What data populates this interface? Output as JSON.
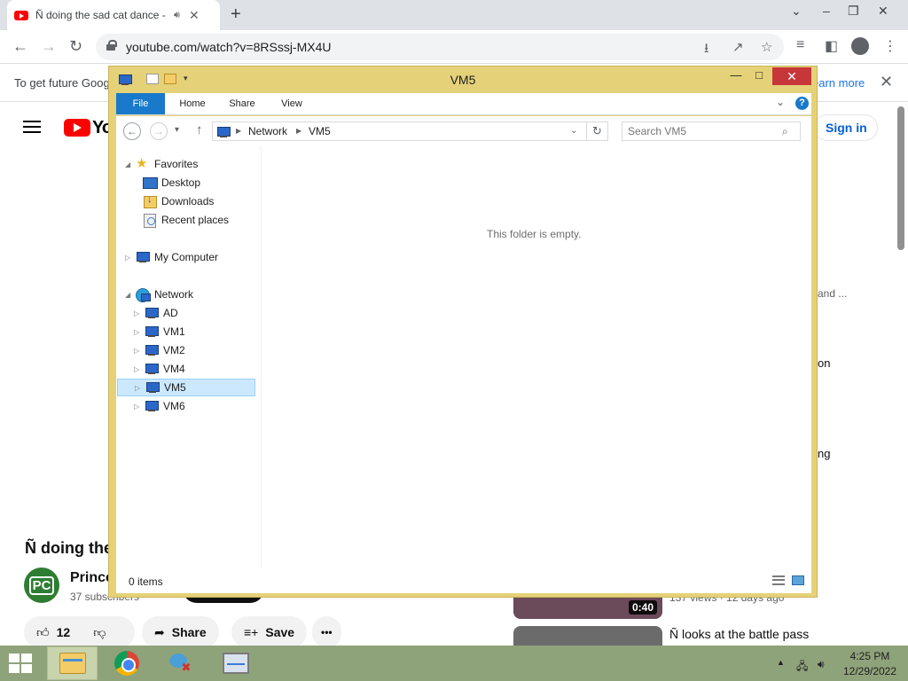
{
  "chrome": {
    "tab_title": "Ñ doing the sad cat dance -",
    "url": "youtube.com/watch?v=8RSssj-MX4U",
    "infobar_text": "To get future Goog",
    "infobar_link": "earn more"
  },
  "youtube": {
    "logo_text": "Yo",
    "signin": "Sign in",
    "sidebar_fragments": [
      "and ...",
      "on",
      "ng"
    ],
    "video_title": "Ñ doing the",
    "channel_avatar_text": "PC",
    "channel_name": "Prince",
    "subscribers": "37 subscribers",
    "like_count": "12",
    "share_label": "Share",
    "save_label": "Save",
    "more_label": "•••",
    "rec_duration": "0:40",
    "rec_meta": "137 views · 12 days ago",
    "rec_title": "Ñ looks at the battle pass"
  },
  "explorer": {
    "title": "VM5",
    "ribbon_tabs": [
      "File",
      "Home",
      "Share",
      "View"
    ],
    "breadcrumb": [
      "Network",
      "VM5"
    ],
    "search_placeholder": "Search VM5",
    "nav": {
      "favorites": "Favorites",
      "favorite_items": [
        "Desktop",
        "Downloads",
        "Recent places"
      ],
      "computer": "My Computer",
      "network": "Network",
      "network_items": [
        "AD",
        "VM1",
        "VM2",
        "VM4",
        "VM5",
        "VM6"
      ],
      "selected": "VM5"
    },
    "empty_message": "This folder is empty.",
    "status": "0 items"
  },
  "taskbar": {
    "time": "4:25 PM",
    "date": "12/29/2022"
  }
}
